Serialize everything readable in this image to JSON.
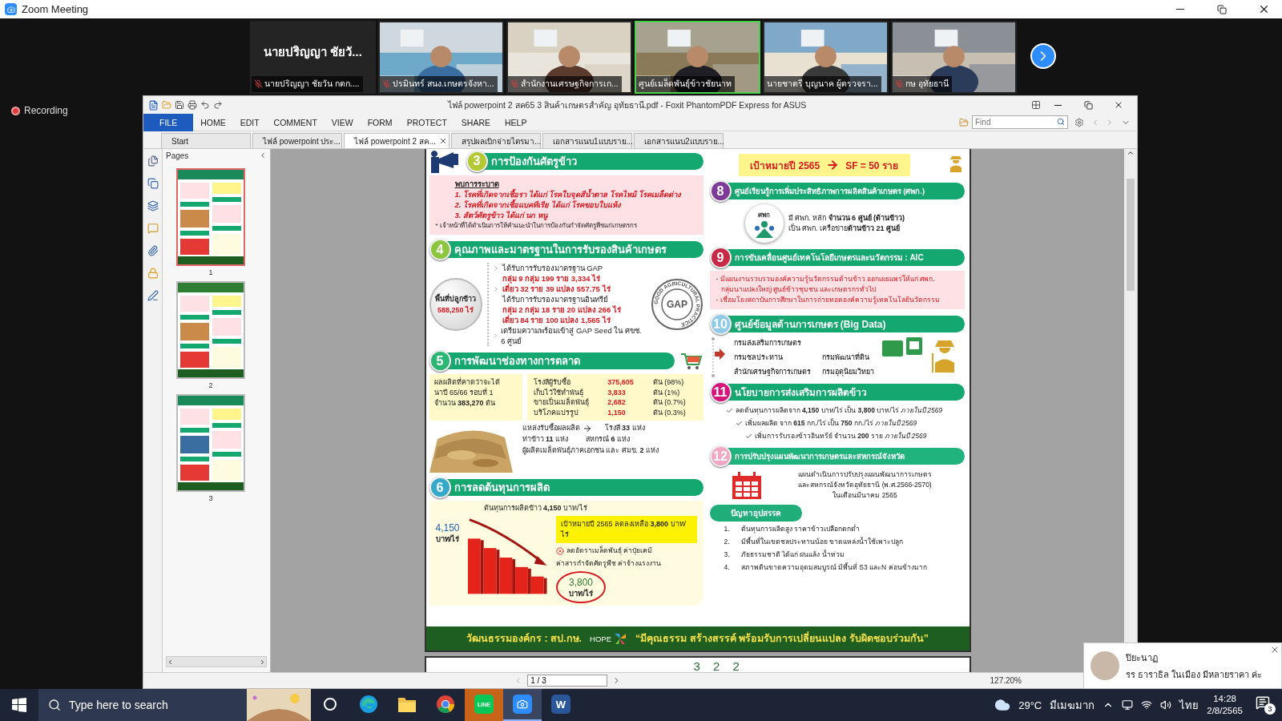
{
  "window": {
    "title": "Zoom Meeting"
  },
  "gallery": {
    "tiles": [
      {
        "kind": "name",
        "name": "นายปริญญา ชัยวั...",
        "label": "นายปริญญา ชัยวัน กตก....",
        "muted": true,
        "speaking": false
      },
      {
        "kind": "video",
        "label": "ปรมินทร์ สนง.เกษตรจังหา...",
        "muted": true,
        "speaking": false
      },
      {
        "kind": "video",
        "label": "สำนักงานเศรษฐกิจการเก...",
        "muted": true,
        "speaking": false
      },
      {
        "kind": "video",
        "label": "ศูนย์เมล็ดพันธุ์ข้าวชัยนาท",
        "muted": false,
        "speaking": true
      },
      {
        "kind": "video",
        "label": "นายชาตรี บุญนาค ผู้ตรวจรา...",
        "muted": false,
        "speaking": false
      },
      {
        "kind": "video",
        "label": "กษ อุทัยธานี",
        "muted": true,
        "speaking": false
      }
    ]
  },
  "recording": "Recording",
  "pdf_viewer": {
    "title": "ไฟล์ powerpoint 2 สค65 3 สินค้าเกษตรสำคัญ อุทัยธานี.pdf - Foxit PhantomPDF Express for ASUS",
    "menu": [
      {
        "label": "FILE",
        "selected": true
      },
      {
        "label": "HOME",
        "selected": false
      },
      {
        "label": "EDIT",
        "selected": false
      },
      {
        "label": "COMMENT",
        "selected": false
      },
      {
        "label": "VIEW",
        "selected": false
      },
      {
        "label": "FORM",
        "selected": false
      },
      {
        "label": "PROTECT",
        "selected": false
      },
      {
        "label": "SHARE",
        "selected": false
      },
      {
        "label": "HELP",
        "selected": false
      }
    ],
    "find_placeholder": "Find",
    "tabs": [
      {
        "label": "Start",
        "selected": false
      },
      {
        "label": "ไฟล์ powerpoint ประ...",
        "selected": false
      },
      {
        "label": "ไฟล์ powerpoint 2 สค...",
        "selected": true
      },
      {
        "label": "สรุปผลเบิกจ่ายไตรมา...",
        "selected": false
      },
      {
        "label": "เอกสารแนบ1แบบราย...",
        "selected": false
      },
      {
        "label": "เอกสารแนบ2แบบราย...",
        "selected": false
      }
    ],
    "pages_title": "Pages",
    "thumbnails": [
      {
        "label": "1",
        "selected": true
      },
      {
        "label": "2",
        "selected": false
      },
      {
        "label": "3",
        "selected": false
      }
    ],
    "page_field": "1 / 3",
    "zoom": "127.20%"
  },
  "document": {
    "left_column": [
      {
        "kind": "pests",
        "number": "3",
        "title": "การป้องกันศัตรูข้าว",
        "color": "#b5c935",
        "heading": "พบการระบาด",
        "lines": [
          "1. โรคที่เกิดจากเชื้อรา ได้แก่ โรคใบจุดสีน้ำตาล โรคไหม้ โรคเมล็ดด่าง",
          "2. โรคที่เกิดจากเชื้อแบคทีเรีย ได้แก่ โรคขอบใบแห้ง",
          "3. สัตว์ศัตรูข้าว ได้แก่ นก หนู"
        ],
        "note": "* เจ้าหน้าที่ได้ดำเนินการให้คำแนะนำในการป้องกันกำจัดศัตรูพืชแก่เกษตรกร"
      },
      {
        "kind": "quality",
        "number": "4",
        "title": "คุณภาพและมาตรฐานในการรับรองสินค้าเกษตร",
        "color": "#8cc63e",
        "area": {
          "label": "พื้นที่ปลูกข้าว",
          "value": "588,250 ไร่"
        },
        "lines": [
          {
            "kind": "plain",
            "text": "ได้รับการรับรองมาตรฐาน GAP",
            "arrow": true
          },
          {
            "kind": "red",
            "text": "**กลุ่ม** 9 กลุ่ม 199 ราย 3,334 ไร่",
            "arrow": false
          },
          {
            "kind": "red",
            "text": "**เดี่ยว** 32 ราย 39 แปลง 557.75 ไร่",
            "arrow": true
          },
          {
            "kind": "plain",
            "text": "ได้รับการรับรองมาตรฐานอินทรีย์",
            "arrow": false
          },
          {
            "kind": "red",
            "text": "**กลุ่ม** 2 กลุ่ม 18 ราย 20 แปลง 266 ไร่",
            "arrow": false
          },
          {
            "kind": "red",
            "text": "**เดี่ยว** 84 ราย 100 แปลง 1,565 ไร่",
            "arrow": false
          },
          {
            "kind": "plain",
            "text": "เตรียมความพร้อมเข้าสู่ GAP Seed ใน ศขช. 6 ศูนย์",
            "arrow": true
          }
        ],
        "stamp": {
          "label": "GAP",
          "ring": "GOOD AGRICULTURAL PRACTICE"
        }
      },
      {
        "kind": "market",
        "number": "5",
        "title": "การพัฒนาช่องทางการตลาด",
        "color": "#2bb673",
        "yield": [
          "ผลผลิตที่คาดว่าจะได้",
          "นาปี 65/66 รอบที่ 1",
          "จำนวน **383,270** ตัน"
        ],
        "distribution": [
          {
            "label": "โรงสีผู้รับซื้อ",
            "value": "375,605",
            "unit": "ตัน (98%)"
          },
          {
            "label": "เก็บไว้ใช้ทำพันธุ์",
            "value": "3,833",
            "unit": "ตัน (1%)"
          },
          {
            "label": "ขายเป็นเมล็ดพันธุ์",
            "value": "2,682",
            "unit": "ตัน (0.7%)"
          },
          {
            "label": "บริโภคแปรรูป",
            "value": "1,150",
            "unit": "ตัน (0.3%)"
          }
        ],
        "sources": [
          "แหล่งรับซื้อผลผลิต",
          "โรงสี **33** แห่ง",
          "ท่าข้าว **11** แห่ง",
          "สหกรณ์ **6** แห่ง",
          "ผู้ผลิตเมล็ดพันธุ์ภาคเอกชน และ ศมข. **2** แห่ง"
        ]
      },
      {
        "kind": "cost",
        "number": "6",
        "title": "การลดต้นทุนการผลิต",
        "color": "#35a9c9",
        "summary": "ต้นทุนการผลิตข้าว **4,150** บาท/ไร่",
        "start": {
          "value": "4,150",
          "unit": "บาท/ไร่"
        },
        "target": "เป้าหมายปี 2565 ลดลงเหลือ **3,800** บาท/ไร่",
        "measures": [
          "ลดอัตราเมล็ดพันธุ์ ค่าปุ๋ยเคมี",
          "ค่าสารกำจัดศัตรูพืช ค่าจ้างแรงงาน"
        ],
        "end": {
          "value": "3,800",
          "unit": "บาท/ไร่"
        }
      }
    ],
    "right_column": [
      {
        "kind": "target",
        "label": "เป้าหมายปี 2565",
        "value": "SF  = 50 ราย"
      },
      {
        "kind": "center",
        "number": "8",
        "title": "ศูนย์เรียนรู้การเพิ่มประสิทธิภาพการผลิตสินค้าเกษตร (ศพก.)",
        "color": "#7d3c98",
        "logo": "ศพก",
        "lines": [
          "มี ศพก. หลัก **จำนวน 6 ศูนย์  (ด้านข้าว)**",
          "เป็น ศพก. เครือข่าย**ด้านข้าว 21 ศูนย์**"
        ]
      },
      {
        "kind": "aic",
        "number": "9",
        "title": "การขับเคลื่อนศูนย์เทคโนโลยีเกษตรและนวัตกรรม : AIC",
        "color": "#c62a47",
        "lines": [
          "- มีแผนงานรวบรวมองค์ความรู้นวัตกรรมด้านข้าว ออกเผยแพร่ให้แก่ ศพก.",
          "กลุ่มนาแปลงใหญ่ ศูนย์ข้าวชุมชน และเกษตรกรทั่วไป",
          "- เชื่อมโยงสถาบันการศึกษาในการถ่ายทอดองค์ความรู้เทคโนโลยีนวัตกรรม"
        ]
      },
      {
        "kind": "bigdata",
        "number": "10",
        "title": "ศูนย์ข้อมูลด้านการเกษตร (Big Data)",
        "color": "#8fcbe9",
        "agencies": [
          "กรมส่งเสริมการเกษตร",
          "กรมชลประทาน",
          "กรมพัฒนาที่ดิน",
          "สำนักเศรษฐกิจการเกษตร",
          "กรมอุตุนิยมวิทยา"
        ]
      },
      {
        "kind": "policy",
        "number": "11",
        "title": "นโยบายการส่งเสริมการผลิตข้าว",
        "color": "#d4157c",
        "items": [
          "ลดต้นทุนการผลิตจาก **4,150** บาท/ไร่ เป็น **3,800** บาท/ไร่ *ภายในปี 2569*",
          "เพิ่มผลผลิต จาก **615** กก./ไร่ เป็น **750** กก./ไร่ *ภายในปี 2569*",
          "เพิ่มการรับรองข้าวอินทรีย์ จำนวน **200** ราย *ภายในปี 2569*"
        ]
      },
      {
        "kind": "plan",
        "number": "12",
        "title": "การปรับปรุงแผนพัฒนาการเกษตรและสหกรณ์จังหวัด",
        "color": "#f2a7c3",
        "lines": [
          "แผนดำเนินการปรับปรุงแผนพัฒนาการเกษตร",
          "และสหกรณ์จังหวัดอุทัยธานี (พ.ศ.2566-2570)",
          "ในเดือนมีนาคม 2565"
        ]
      },
      {
        "kind": "problems",
        "title": "ปัญหาอุปสรรค",
        "items": [
          {
            "marker": "1.",
            "text": "ต้นทุนการผลิตสูง ราคาข้าวเปลือกตกต่ำ"
          },
          {
            "marker": "2.",
            "text": "มีพื้นที่ในเขตชลประทานน้อย ขาดแหล่งน้ำใช้เพาะปลูก"
          },
          {
            "marker": "3.",
            "text": "ภัยธรรมชาติ ได้แก่ ฝนแล้ง น้ำท่วม"
          },
          {
            "marker": "4.",
            "text": "สภาพดินขาดความอุดมสมบูรณ์ มีพื้นที่ S3 และN ค่อนข้างมาก"
          }
        ]
      }
    ],
    "footer": {
      "culture": "วัฒนธรรมองค์กร : สป.กษ.",
      "brand": "HOPE",
      "slogan": "“มีคุณธรรม สร้างสรรค์ พร้อมรับการเปลี่ยนแปลง รับผิดชอบร่วมกัน”"
    },
    "next_page": "3 2 2"
  },
  "notification": {
    "sender": "ปิยะนาฏ",
    "message": "รร ธาราธิล ในเมือง มีหลายราคา ค่ะ"
  },
  "taskbar": {
    "search_placeholder": "Type here to search",
    "apps": [
      {
        "kind": "cortana",
        "flashing": false,
        "active": false
      },
      {
        "kind": "edge",
        "flashing": false,
        "active": false
      },
      {
        "kind": "explorer",
        "flashing": false,
        "active": false
      },
      {
        "kind": "chrome",
        "flashing": false,
        "active": false
      },
      {
        "kind": "line",
        "label": "LINE",
        "flashing": true,
        "active": false
      },
      {
        "kind": "zoom",
        "flashing": false,
        "active": true
      },
      {
        "kind": "word",
        "label": "W",
        "flashing": false,
        "active": false
      }
    ],
    "temperature": "29°C",
    "condition": "มีเมฆมาก",
    "language": "ไทย",
    "time": "14:28",
    "date": "2/8/2565",
    "notification_count": "3"
  }
}
